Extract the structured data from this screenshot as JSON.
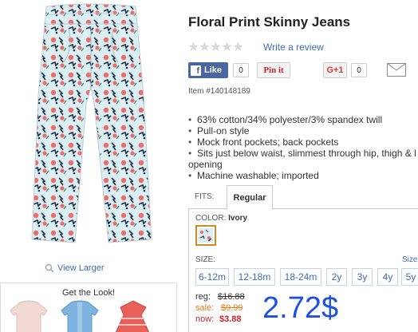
{
  "product": {
    "title": "Floral Print Skinny Jeans",
    "item_number": "Item #140148189"
  },
  "rating": {
    "stars": 0,
    "max_stars": 5,
    "write_review_label": "Write a review"
  },
  "share": {
    "facebook_label": "Like",
    "facebook_count": "0",
    "pinterest_label": "Pin it",
    "gplus_label": "G+1",
    "gplus_count": "0"
  },
  "features": [
    "63% cotton/34% polyester/3% spandex twill",
    "Pull-on style",
    "Mock front pockets; back pockets",
    "Sits just below waist, slimmest through hip, thigh & l",
    "opening",
    "Machine washable; imported"
  ],
  "fit": {
    "label": "FITS:",
    "selected": "Regular"
  },
  "color": {
    "label": "COLOR:",
    "value": "Ivory"
  },
  "size": {
    "label": "SIZE:",
    "chart_link": "Size",
    "options": [
      "6-12m",
      "12-18m",
      "18-24m",
      "2y",
      "3y",
      "4y",
      "5y"
    ]
  },
  "pricing": {
    "reg_label": "reg:",
    "reg_value": "$16.88",
    "sale_label": "sale:",
    "sale_value": "$9.99",
    "now_label": "now:",
    "now_value": "$3.88",
    "overlay_price": "2.72$"
  },
  "left": {
    "view_larger_label": "View Larger",
    "get_look_title": "Get the Look!"
  },
  "colors": {
    "link_blue": "#3a6fb5",
    "facebook_blue": "#4a66a0",
    "pinterest_red": "#c8232c",
    "sale_orange": "#e07a17",
    "now_red": "#c8232c",
    "overlay_blue": "#1d4fe0"
  },
  "icons": {
    "magnifier": "magnifier-icon",
    "mail": "mail-icon",
    "star": "star-icon"
  }
}
